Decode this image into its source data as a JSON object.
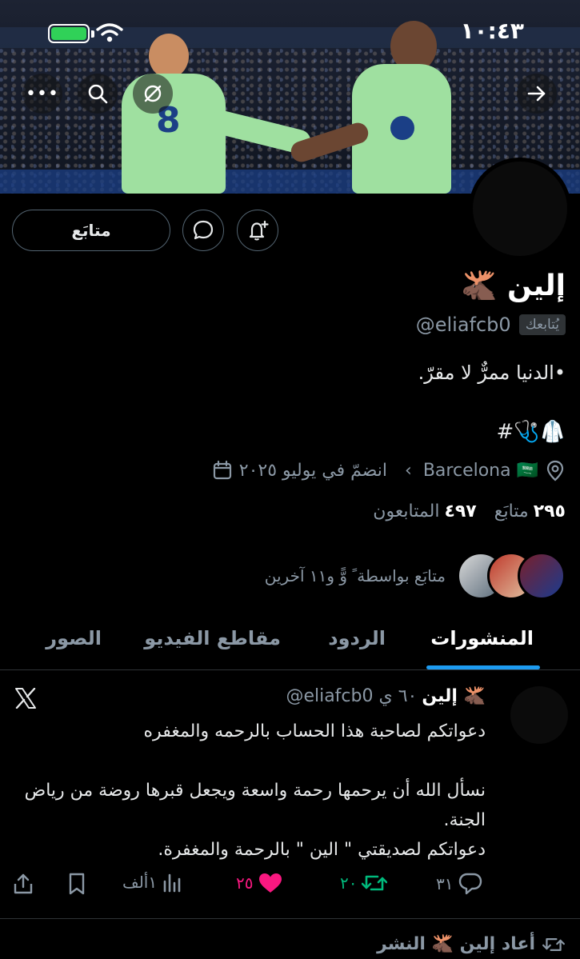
{
  "status_bar": {
    "time": "١٠:٤٣"
  },
  "profile": {
    "name": "إلين 🫎",
    "handle": "@eliafcb0",
    "follows_you": "يُتابعك",
    "bio_line1": "•الدنيا ممرٌّ لا مقرّ.",
    "bio_line2": "#🩺🥼",
    "location": "Barcelona 🇸🇦",
    "joined": "انضمّ في يوليو ٢٠٢٥",
    "following_count": "٢٩٥",
    "following_label": "متابَع",
    "followers_count": "٤٩٧",
    "followers_label": "المتابعون",
    "followed_by": "متابَع بواسطة ً وًّ و١١ آخرين"
  },
  "actions": {
    "follow_label": "متابَع"
  },
  "tabs": [
    {
      "label": "المنشورات",
      "active": true
    },
    {
      "label": "الردود",
      "active": false
    },
    {
      "label": "مقاطع الفيديو",
      "active": false
    },
    {
      "label": "الصور",
      "active": false
    }
  ],
  "post": {
    "author": "إلين 🫎",
    "handle_time": "@eliafcb0 ٦٠ ي",
    "text": "دعواتكم لصاحبة هذا الحساب بالرحمه والمغفره\n\nنسأل الله أن يرحمها رحمة واسعة ويجعل قبرها روضة من رياض الجنة.\nدعواتكم لصديقتي \" الين \" بالرحمة والمغفرة.",
    "replies": "٣١",
    "reposts": "٢٠",
    "likes": "٢٥",
    "views": "١ألف"
  },
  "next_item": {
    "reposted_by": "أعاد إلين 🫎 النشر"
  },
  "colors": {
    "accent": "#1d9bf0",
    "like": "#f91880",
    "repost": "#00ba7c",
    "muted": "#8b98a5",
    "border": "#536471"
  }
}
